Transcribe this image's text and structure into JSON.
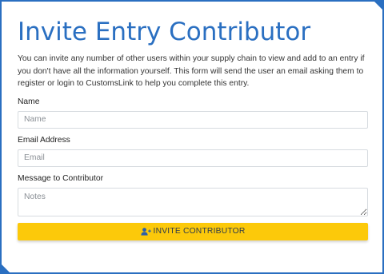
{
  "form": {
    "title": "Invite Entry Contributor",
    "description": "You can invite any number of other users within your supply chain to view and add to an entry if you don't have all the information yourself. This form will send the user an email asking them to register or login to CustomsLink to help you complete this entry.",
    "name_label": "Name",
    "name_placeholder": "Name",
    "name_value": "",
    "email_label": "Email Address",
    "email_placeholder": "Email",
    "email_value": "",
    "message_label": "Message to Contributor",
    "message_placeholder": "Notes",
    "message_value": "",
    "submit_label": "INVITE CONTRIBUTOR",
    "submit_icon": "user-plus-icon"
  },
  "colors": {
    "brand_blue": "#2a6fc1",
    "button_yellow": "#fcc90a",
    "button_text": "#2d3a4a"
  }
}
